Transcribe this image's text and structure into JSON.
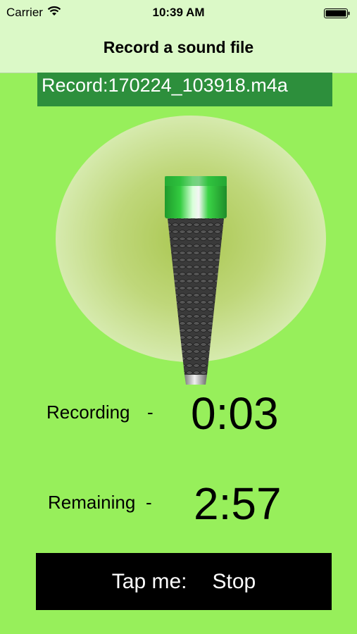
{
  "status_bar": {
    "carrier": "Carrier",
    "time": "10:39 AM",
    "wifi_icon": "wifi-icon",
    "battery_icon": "battery-icon"
  },
  "nav": {
    "title": "Record a sound file"
  },
  "file": {
    "label": "Record:170224_103918.m4a"
  },
  "mic": {
    "icon": "microphone-icon"
  },
  "recording": {
    "label": "Recording",
    "separator": "-",
    "value": "0:03"
  },
  "remaining": {
    "label": "Remaining",
    "separator": "-",
    "value": "2:57"
  },
  "button": {
    "prefix": "Tap me:",
    "action": "Stop"
  },
  "colors": {
    "background": "#97ef5b",
    "top_bar": "#dbf9c7",
    "file_banner": "#2d8f3c",
    "button": "#000000"
  }
}
